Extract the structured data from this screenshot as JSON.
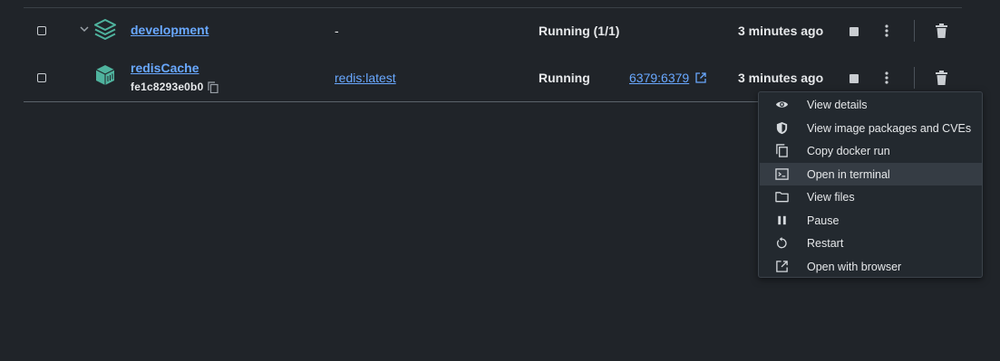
{
  "rows": [
    {
      "name": "development",
      "image": "-",
      "status": "Running (1/1)",
      "port": "",
      "last_started": "3 minutes ago"
    },
    {
      "name": "redisCache",
      "container_id": "fe1c8293e0b0",
      "image": "redis:latest",
      "status": "Running",
      "port": "6379:6379",
      "last_started": "3 minutes ago"
    }
  ],
  "context_menu": {
    "items": [
      {
        "label": "View details",
        "icon": "eye-icon"
      },
      {
        "label": "View image packages and CVEs",
        "icon": "shield-icon"
      },
      {
        "label": "Copy docker run",
        "icon": "copy-icon"
      },
      {
        "label": "Open in terminal",
        "icon": "terminal-icon",
        "highlighted": true
      },
      {
        "label": "View files",
        "icon": "folder-icon"
      },
      {
        "label": "Pause",
        "icon": "pause-icon"
      },
      {
        "label": "Restart",
        "icon": "restart-icon"
      },
      {
        "label": "Open with browser",
        "icon": "external-link-icon"
      }
    ]
  },
  "colors": {
    "background": "#202429",
    "link": "#69a8ff",
    "accent_icon": "#4fb39e",
    "menu_background": "#23292f",
    "menu_highlight": "#353c44"
  }
}
